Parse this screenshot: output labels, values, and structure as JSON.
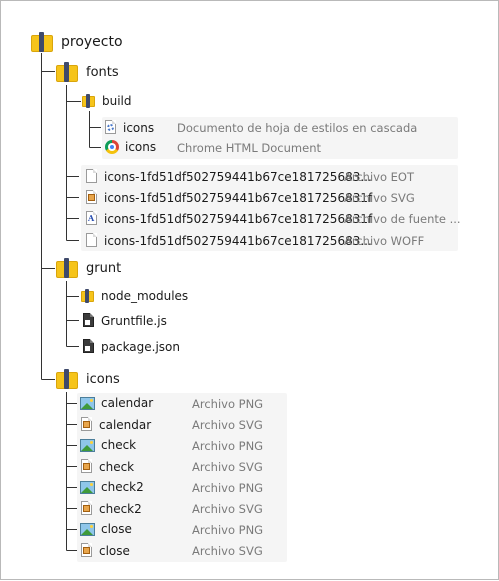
{
  "root": {
    "label": "proyecto",
    "icon": "folder-icon"
  },
  "fonts": {
    "label": "fonts",
    "build": {
      "label": "build",
      "files": [
        {
          "name": "icons",
          "type": "Documento de hoja de estilos en cascada",
          "icon": "css-file-icon"
        },
        {
          "name": "icons",
          "type": "Chrome HTML Document",
          "icon": "chrome-icon"
        }
      ]
    },
    "files": [
      {
        "name": "icons-1fd51df502759441b67ce181725683...",
        "type": "Archivo EOT",
        "icon": "blank-file-icon"
      },
      {
        "name": "icons-1fd51df502759441b67ce1817256831f",
        "type": "Archivo SVG",
        "icon": "svg-file-icon"
      },
      {
        "name": "icons-1fd51df502759441b67ce1817256831f",
        "type": "Archivo de fuente ...",
        "icon": "font-file-icon"
      },
      {
        "name": "icons-1fd51df502759441b67ce181725683...",
        "type": "Archivo WOFF",
        "icon": "blank-file-icon"
      }
    ]
  },
  "grunt": {
    "label": "grunt",
    "items": [
      {
        "name": "node_modules",
        "icon": "folder-icon"
      },
      {
        "name": "Gruntfile.js",
        "icon": "js-file-icon"
      },
      {
        "name": "package.json",
        "icon": "json-file-icon"
      }
    ]
  },
  "icons": {
    "label": "icons",
    "files": [
      {
        "name": "calendar",
        "type": "Archivo PNG",
        "icon": "png-file-icon"
      },
      {
        "name": "calendar",
        "type": "Archivo SVG",
        "icon": "svg-file-icon"
      },
      {
        "name": "check",
        "type": "Archivo PNG",
        "icon": "png-file-icon"
      },
      {
        "name": "check",
        "type": "Archivo SVG",
        "icon": "svg-file-icon"
      },
      {
        "name": "check2",
        "type": "Archivo PNG",
        "icon": "png-file-icon"
      },
      {
        "name": "check2",
        "type": "Archivo SVG",
        "icon": "svg-file-icon"
      },
      {
        "name": "close",
        "type": "Archivo PNG",
        "icon": "png-file-icon"
      },
      {
        "name": "close",
        "type": "Archivo SVG",
        "icon": "svg-file-icon"
      }
    ]
  },
  "colors": {
    "folder": "#f6c41a",
    "folder_band": "#3f4a6b",
    "tree_line": "#333333",
    "type_text": "#7a7a7a",
    "panel_bg": "#f5f5f5"
  }
}
